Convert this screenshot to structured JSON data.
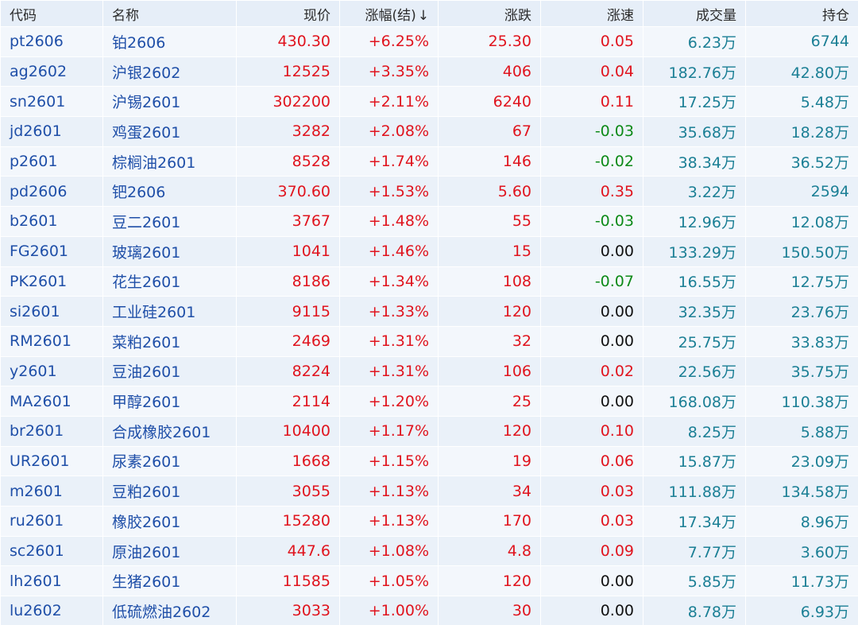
{
  "columns": {
    "code": "代码",
    "name": "名称",
    "price": "现价",
    "pct": "涨幅(结)",
    "sort_icon": "↓",
    "change": "涨跌",
    "speed": "涨速",
    "volume": "成交量",
    "open_interest": "持仓"
  },
  "colors": {
    "up": "#e0141e",
    "down": "#0d8a18",
    "flat": "#111111",
    "code_link": "#1f4fa8",
    "volume_text": "#1b7f95",
    "header_bg": "#e6eef8"
  },
  "rows": [
    {
      "code": "pt2606",
      "name": "铂2606",
      "price": "430.30",
      "pct": "+6.25%",
      "change": "25.30",
      "speed": "0.05",
      "speed_dir": "up",
      "volume": "6.23万",
      "oi": "6744"
    },
    {
      "code": "ag2602",
      "name": "沪银2602",
      "price": "12525",
      "pct": "+3.35%",
      "change": "406",
      "speed": "0.04",
      "speed_dir": "up",
      "volume": "182.76万",
      "oi": "42.80万"
    },
    {
      "code": "sn2601",
      "name": "沪锡2601",
      "price": "302200",
      "pct": "+2.11%",
      "change": "6240",
      "speed": "0.11",
      "speed_dir": "up",
      "volume": "17.25万",
      "oi": "5.48万"
    },
    {
      "code": "jd2601",
      "name": "鸡蛋2601",
      "price": "3282",
      "pct": "+2.08%",
      "change": "67",
      "speed": "-0.03",
      "speed_dir": "down",
      "volume": "35.68万",
      "oi": "18.28万"
    },
    {
      "code": "p2601",
      "name": "棕榈油2601",
      "price": "8528",
      "pct": "+1.74%",
      "change": "146",
      "speed": "-0.02",
      "speed_dir": "down",
      "volume": "38.34万",
      "oi": "36.52万"
    },
    {
      "code": "pd2606",
      "name": "钯2606",
      "price": "370.60",
      "pct": "+1.53%",
      "change": "5.60",
      "speed": "0.35",
      "speed_dir": "up",
      "volume": "3.22万",
      "oi": "2594"
    },
    {
      "code": "b2601",
      "name": "豆二2601",
      "price": "3767",
      "pct": "+1.48%",
      "change": "55",
      "speed": "-0.03",
      "speed_dir": "down",
      "volume": "12.96万",
      "oi": "12.08万"
    },
    {
      "code": "FG2601",
      "name": "玻璃2601",
      "price": "1041",
      "pct": "+1.46%",
      "change": "15",
      "speed": "0.00",
      "speed_dir": "flat",
      "volume": "133.29万",
      "oi": "150.50万"
    },
    {
      "code": "PK2601",
      "name": "花生2601",
      "price": "8186",
      "pct": "+1.34%",
      "change": "108",
      "speed": "-0.07",
      "speed_dir": "down",
      "volume": "16.55万",
      "oi": "12.75万"
    },
    {
      "code": "si2601",
      "name": "工业硅2601",
      "price": "9115",
      "pct": "+1.33%",
      "change": "120",
      "speed": "0.00",
      "speed_dir": "flat",
      "volume": "32.35万",
      "oi": "23.76万"
    },
    {
      "code": "RM2601",
      "name": "菜粕2601",
      "price": "2469",
      "pct": "+1.31%",
      "change": "32",
      "speed": "0.00",
      "speed_dir": "flat",
      "volume": "25.75万",
      "oi": "33.83万"
    },
    {
      "code": "y2601",
      "name": "豆油2601",
      "price": "8224",
      "pct": "+1.31%",
      "change": "106",
      "speed": "0.02",
      "speed_dir": "up",
      "volume": "22.56万",
      "oi": "35.75万"
    },
    {
      "code": "MA2601",
      "name": "甲醇2601",
      "price": "2114",
      "pct": "+1.20%",
      "change": "25",
      "speed": "0.00",
      "speed_dir": "flat",
      "volume": "168.08万",
      "oi": "110.38万"
    },
    {
      "code": "br2601",
      "name": "合成橡胶2601",
      "price": "10400",
      "pct": "+1.17%",
      "change": "120",
      "speed": "0.10",
      "speed_dir": "up",
      "volume": "8.25万",
      "oi": "5.88万"
    },
    {
      "code": "UR2601",
      "name": "尿素2601",
      "price": "1668",
      "pct": "+1.15%",
      "change": "19",
      "speed": "0.06",
      "speed_dir": "up",
      "volume": "15.87万",
      "oi": "23.09万"
    },
    {
      "code": "m2601",
      "name": "豆粕2601",
      "price": "3055",
      "pct": "+1.13%",
      "change": "34",
      "speed": "0.03",
      "speed_dir": "up",
      "volume": "111.88万",
      "oi": "134.58万"
    },
    {
      "code": "ru2601",
      "name": "橡胶2601",
      "price": "15280",
      "pct": "+1.13%",
      "change": "170",
      "speed": "0.03",
      "speed_dir": "up",
      "volume": "17.34万",
      "oi": "8.96万"
    },
    {
      "code": "sc2601",
      "name": "原油2601",
      "price": "447.6",
      "pct": "+1.08%",
      "change": "4.8",
      "speed": "0.09",
      "speed_dir": "up",
      "volume": "7.77万",
      "oi": "3.60万"
    },
    {
      "code": "lh2601",
      "name": "生猪2601",
      "price": "11585",
      "pct": "+1.05%",
      "change": "120",
      "speed": "0.00",
      "speed_dir": "flat",
      "volume": "5.85万",
      "oi": "11.73万"
    },
    {
      "code": "lu2602",
      "name": "低硫燃油2602",
      "price": "3033",
      "pct": "+1.00%",
      "change": "30",
      "speed": "0.00",
      "speed_dir": "flat",
      "volume": "8.78万",
      "oi": "6.93万"
    }
  ]
}
